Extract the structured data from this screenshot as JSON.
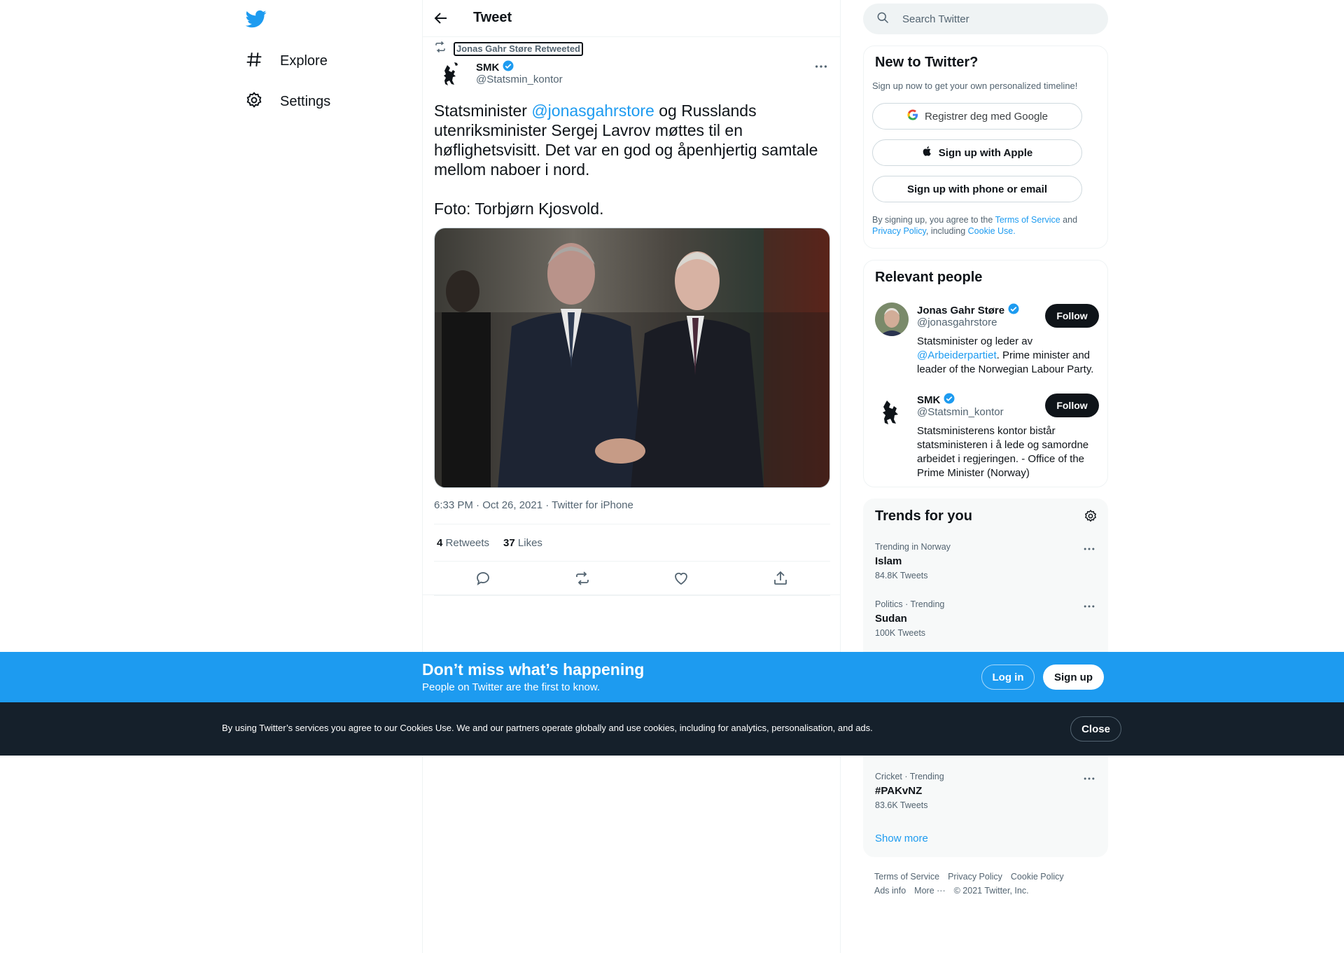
{
  "nav": {
    "explore": "Explore",
    "settings": "Settings"
  },
  "header": {
    "title": "Tweet"
  },
  "tweet": {
    "retweeted_by": "Jonas Gahr Støre Retweeted",
    "author_name": "SMK",
    "author_handle": "@Statsmin_kontor",
    "text_before_mention": "Statsminister ",
    "mention": "@jonasgahrstore",
    "text_after_mention": " og Russlands utenriksminister Sergej Lavrov møttes til en høflighetsvisitt. Det var en god og åpenhjertig samtale mellom naboer i nord.",
    "text_photo_credit": "Foto: Torbjørn Kjosvold.",
    "meta": "6:33 PM · Oct 26, 2021 · Twitter for iPhone",
    "retweets_count": "4",
    "retweets_label": "Retweets",
    "likes_count": "37",
    "likes_label": "Likes"
  },
  "search": {
    "placeholder": "Search Twitter"
  },
  "new_to_twitter": {
    "title": "New to Twitter?",
    "subtitle": "Sign up now to get your own personalized timeline!",
    "google_label": "Registrer deg med Google",
    "apple_label": "Sign up with Apple",
    "phone_label": "Sign up with phone or email",
    "legal_prefix": "By signing up, you agree to the ",
    "terms_link": "Terms of Service",
    "legal_and": " and ",
    "privacy_link": "Privacy Policy",
    "legal_including": ", including ",
    "cookie_link": "Cookie Use."
  },
  "relevant_people": {
    "title": "Relevant people",
    "people": [
      {
        "name": "Jonas Gahr Støre",
        "handle": "@jonasgahrstore",
        "bio_before": "Statsminister og leder av ",
        "bio_link": "@Arbeiderpartiet",
        "bio_after": ". Prime minister and leader of the Norwegian Labour Party.",
        "follow_label": "Follow"
      },
      {
        "name": "SMK",
        "handle": "@Statsmin_kontor",
        "bio": "Statsministerens kontor bistår statsministeren i å lede og samordne arbeidet i regjeringen. - Office of the Prime Minister (Norway)",
        "follow_label": "Follow"
      }
    ]
  },
  "trends": {
    "title": "Trends for you",
    "items": [
      {
        "context": "Trending in Norway",
        "name": "Islam",
        "count": "84.8K Tweets"
      },
      {
        "context": "Politics · Trending",
        "name": "Sudan",
        "count": "100K Tweets"
      },
      {
        "context": "Cricket · Trending",
        "name": "#PAKvNZ",
        "count": "83.6K Tweets"
      }
    ],
    "show_more": "Show more"
  },
  "footer": {
    "terms": "Terms of Service",
    "privacy": "Privacy Policy",
    "cookie": "Cookie Policy",
    "ads": "Ads info",
    "more": "More ···",
    "copyright": "© 2021 Twitter, Inc."
  },
  "banner": {
    "title": "Don’t miss what’s happening",
    "subtitle": "People on Twitter are the first to know.",
    "login": "Log in",
    "signup": "Sign up"
  },
  "cookie_bar": {
    "text": "By using Twitter’s services you agree to our Cookies Use. We and our partners operate globally and use cookies, including for analytics, personalisation, and ads.",
    "close": "Close"
  },
  "colors": {
    "accent": "#1d9bf0",
    "text": "#0f1419",
    "muted": "#536471",
    "cookie_bg": "#15202b"
  }
}
